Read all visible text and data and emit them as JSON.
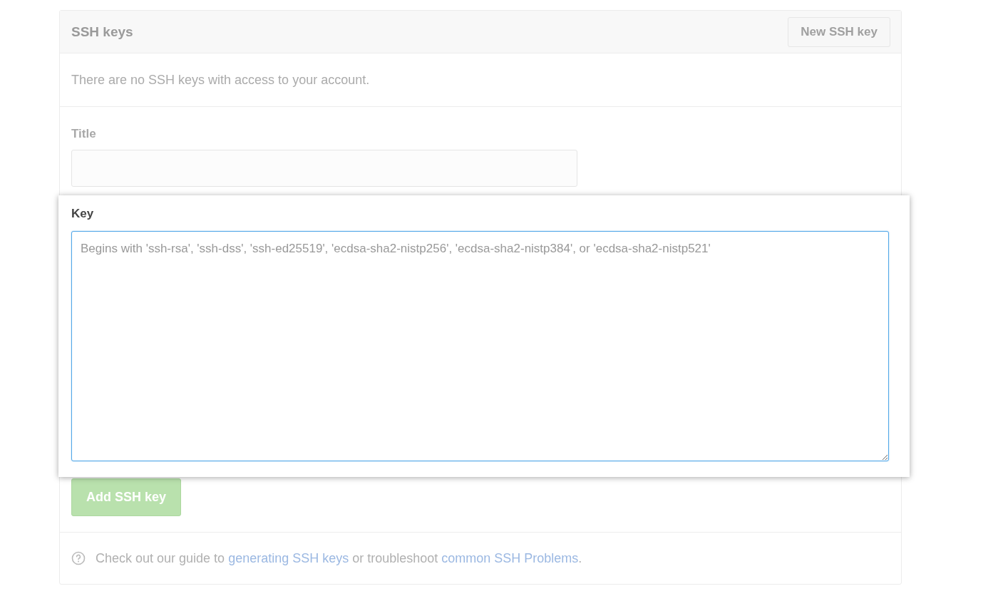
{
  "panel": {
    "title": "SSH keys",
    "new_button": "New SSH key"
  },
  "empty_message": "There are no SSH keys with access to your account.",
  "form": {
    "title_label": "Title",
    "key_label": "Key",
    "key_placeholder": "Begins with 'ssh-rsa', 'ssh-dss', 'ssh-ed25519', 'ecdsa-sha2-nistp256', 'ecdsa-sha2-nistp384', or 'ecdsa-sha2-nistp521'",
    "submit_button": "Add SSH key",
    "submit_disabled": true
  },
  "footer": [
    {
      "kind": "text",
      "text": "Check out our guide to "
    },
    {
      "kind": "link",
      "text": "generating SSH keys"
    },
    {
      "kind": "text",
      "text": " or troubleshoot "
    },
    {
      "kind": "link",
      "text": "common SSH Problems"
    },
    {
      "kind": "text",
      "text": "."
    }
  ]
}
